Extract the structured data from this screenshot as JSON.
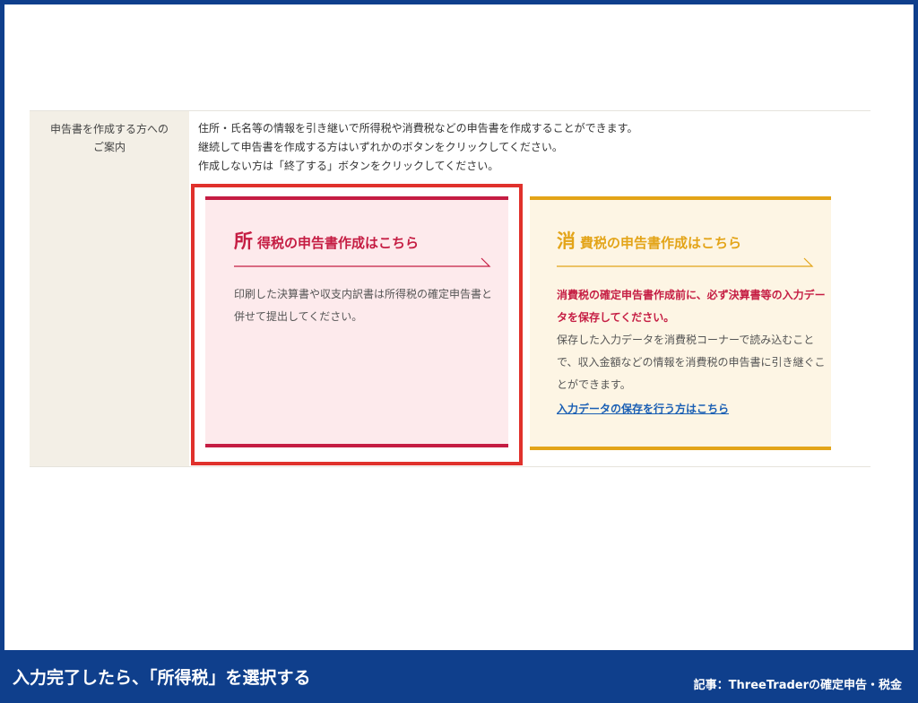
{
  "guide": {
    "label_line1": "申告書を作成する方への",
    "label_line2": "ご案内",
    "instructions": [
      "住所・氏名等の情報を引き継いで所得税や消費税などの申告書を作成することができます。",
      "継続して申告書を作成する方はいずれかのボタンをクリックしてください。",
      "作成しない方は「終了する」ボタンをクリックしてください。"
    ]
  },
  "income_card": {
    "heading_first": "所",
    "heading_rest": "得税の申告書作成はこちら",
    "description": "印刷した決算書や収支内訳書は所得税の確定申告書と併せて提出してください。",
    "accent": "#c51d43",
    "background": "#fdeaec"
  },
  "consumption_card": {
    "heading_first": "消",
    "heading_rest": "費税の申告書作成はこちら",
    "warning": "消費税の確定申告書作成前に、必ず決算書等の入力データを保存してください。",
    "description": "保存した入力データを消費税コーナーで読み込むことで、収入金額などの情報を消費税の申告書に引き継ぐことができます。",
    "link": "入力データの保存を行う方はこちら",
    "accent": "#e3a418",
    "background": "#fdf5e4"
  },
  "highlight_color": "#e0312c",
  "caption": "入力完了したら、「所得税」を選択する",
  "credit": "記事：ThreeTraderの確定申告・税金",
  "brand_color": "#0f3f8c"
}
